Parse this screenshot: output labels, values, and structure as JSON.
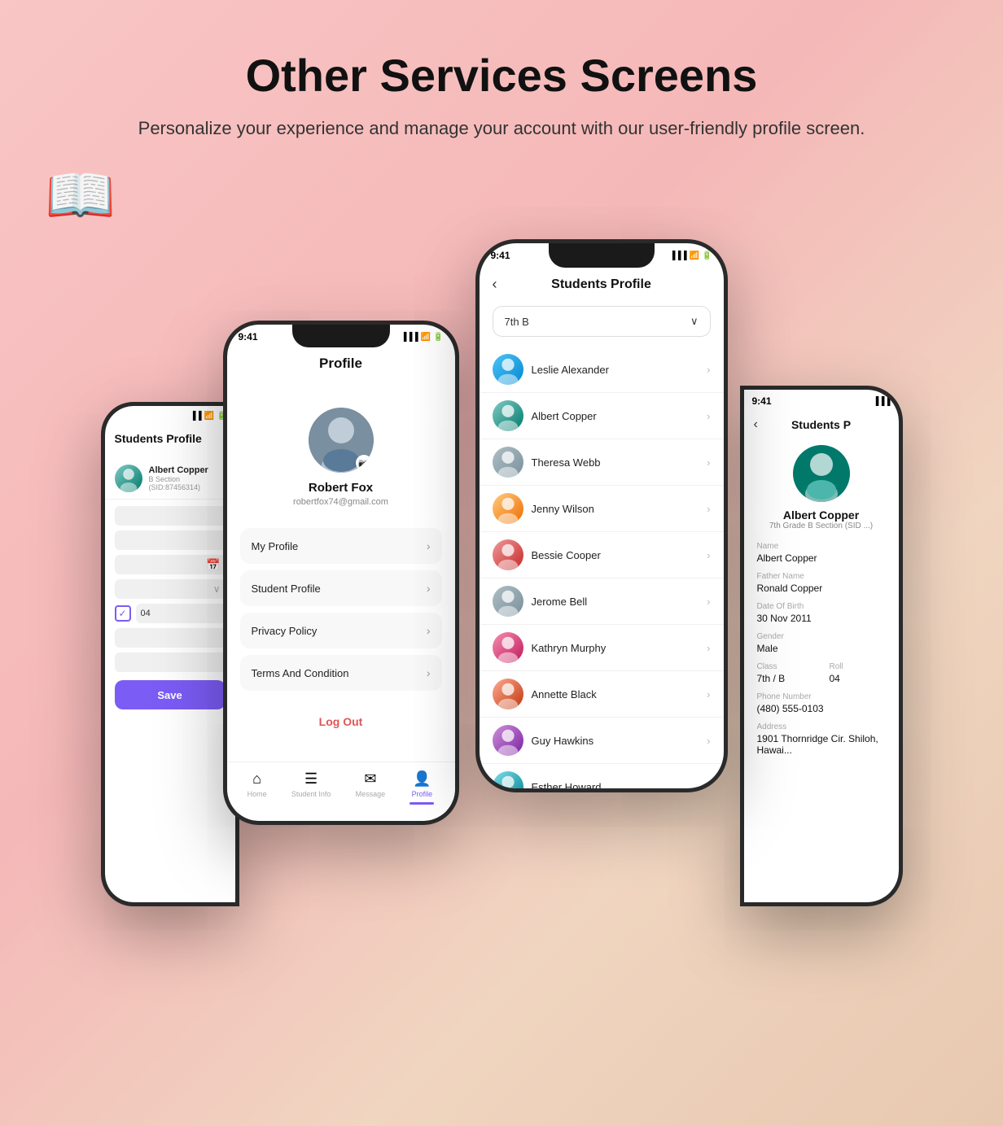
{
  "header": {
    "title": "Other Services Screens",
    "subtitle": "Personalize your experience and manage your account with our user-friendly profile screen."
  },
  "phone_profile": {
    "time": "9:41",
    "title": "Profile",
    "user": {
      "name": "Robert Fox",
      "email": "robertfox74@gmail.com"
    },
    "menu": [
      {
        "label": "My Profile"
      },
      {
        "label": "Student Profile"
      },
      {
        "label": "Privacy Policy"
      },
      {
        "label": "Terms And Condition"
      }
    ],
    "logout_label": "Log Out",
    "nav": [
      {
        "label": "Home",
        "icon": "⌂",
        "active": false
      },
      {
        "label": "Student Info",
        "icon": "☰",
        "active": false
      },
      {
        "label": "Message",
        "icon": "✉",
        "active": false
      },
      {
        "label": "Profile",
        "icon": "👤",
        "active": true
      }
    ]
  },
  "phone_students": {
    "time": "9:41",
    "title": "Students Profile",
    "dropdown": "7th B",
    "students": [
      {
        "name": "Leslie Alexander",
        "color": "av-blue"
      },
      {
        "name": "Albert Copper",
        "color": "av-teal"
      },
      {
        "name": "Theresa Webb",
        "color": "av-gray"
      },
      {
        "name": "Jenny Wilson",
        "color": "av-peach"
      },
      {
        "name": "Bessie Cooper",
        "color": "av-red"
      },
      {
        "name": "Jerome Bell",
        "color": "av-gray"
      },
      {
        "name": "Kathryn Murphy",
        "color": "av-pink"
      },
      {
        "name": "Annette Black",
        "color": "av-orange"
      },
      {
        "name": "Guy Hawkins",
        "color": "av-purple"
      },
      {
        "name": "Esther Howard",
        "color": "av-cyan"
      }
    ]
  },
  "phone_left": {
    "title": "Students Profile",
    "students": [
      {
        "name": "Albert Copper",
        "sub": "B Section (SID:87456314)",
        "color": "av-teal"
      }
    ],
    "save_label": "Save"
  },
  "phone_right": {
    "time": "9:41",
    "title": "Students P",
    "student": {
      "name": "Albert Copper",
      "grade": "7th Grade B Section (SID ...)",
      "fields": [
        {
          "label": "Name",
          "value": "Albert Copper"
        },
        {
          "label": "Father Name",
          "value": "Ronald Copper"
        },
        {
          "label": "Date Of Birth",
          "value": "30 Nov 2011"
        },
        {
          "label": "Gender",
          "value": "Male"
        },
        {
          "label": "Class",
          "value": "7th / B"
        },
        {
          "label": "Roll",
          "value": "04"
        },
        {
          "label": "Phone Number",
          "value": "(480) 555-0103"
        },
        {
          "label": "Address",
          "value": "1901 Thornridge Cir. Shiloh, Hawai..."
        }
      ]
    }
  }
}
